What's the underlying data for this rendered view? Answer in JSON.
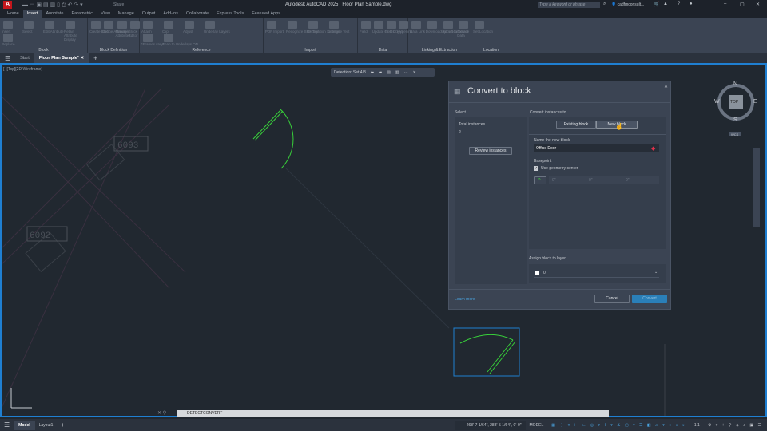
{
  "app": {
    "logo": "A",
    "title": "Autodesk AutoCAD 2025",
    "file": "Floor Plan Sample.dwg",
    "share": "Share",
    "search_placeholder": "Type a keyword or phrase",
    "user": "cadfmconsult...",
    "window_controls": [
      "minimize-icon",
      "restore-icon",
      "close-icon"
    ]
  },
  "ribbon_tabs": [
    "Home",
    "Insert",
    "Annotate",
    "Parametric",
    "View",
    "Manage",
    "Output",
    "Add-ins",
    "Collaborate",
    "Express Tools",
    "Featured Apps"
  ],
  "active_ribbon_tab": "Insert",
  "panels": [
    {
      "label": "Block",
      "items": [
        "Insert",
        "Select",
        "Edit Attribute",
        "Retain Attribute Display",
        "Replace"
      ]
    },
    {
      "label": "Block Definition",
      "items": [
        "Create Block",
        "Define Attributes",
        "Manage Attributes",
        "Block Editor"
      ]
    },
    {
      "label": "Reference",
      "items": [
        "Attach",
        "Clip",
        "Adjust",
        "Underlay Layers",
        "*Frames vary*",
        "Snap to Underlays ON"
      ]
    },
    {
      "label": "Import",
      "items": [
        "PDF Import",
        "Recognize SHX Text",
        "Recognition Settings",
        "Combine Text"
      ]
    },
    {
      "label": "Data",
      "items": [
        "Field",
        "Update Fields",
        "OLE Object",
        "Hyperlink"
      ]
    },
    {
      "label": "Linking & Extraction",
      "items": [
        "Data Link",
        "Download from Source",
        "Upload to Source",
        "Extract Data"
      ]
    },
    {
      "label": "Location",
      "items": [
        "Set Location"
      ]
    }
  ],
  "doc_tabs": [
    "Start",
    "Floor Plan Sample*"
  ],
  "viewport_label": "[-][Top][2D Wireframe]",
  "detection_bar": {
    "label": "Detection: Set 4/8"
  },
  "drawing_labels": [
    "6093",
    "6092"
  ],
  "viewcube": {
    "top": "TOP",
    "n": "N",
    "s": "S",
    "e": "E",
    "w": "W",
    "wcs": "WCS"
  },
  "dialog": {
    "title": "Convert to block",
    "select_label": "Select",
    "total_instances_label": "Total instances",
    "total_instances": "2",
    "review_button": "Review instances",
    "convert_to_label": "Convert instances to",
    "toggle": [
      "Existing block",
      "New block"
    ],
    "toggle_selected": "New block",
    "name_label": "Name the new block",
    "name_value": "Office Door",
    "basepoint_label": "Basepoint",
    "use_geometry_center": "Use geometry center",
    "use_geometry_center_checked": true,
    "coords": [
      "0\"",
      "0\"",
      "0\""
    ],
    "layer_label": "Assign block to layer",
    "layer_value": "0",
    "learn_more": "Learn more",
    "cancel": "Cancel",
    "convert": "Convert"
  },
  "command_line": "DETECTCONVERT",
  "layout_tabs": [
    "Model",
    "Layout1"
  ],
  "status": {
    "coords": "268'-7 1/64\", 288'-5 1/64\", 0'-0\"",
    "model": "MODEL",
    "scale": "1:1"
  },
  "colors": {
    "accent": "#1f7fd1",
    "door": "#38d13a",
    "error": "#e0314a"
  }
}
